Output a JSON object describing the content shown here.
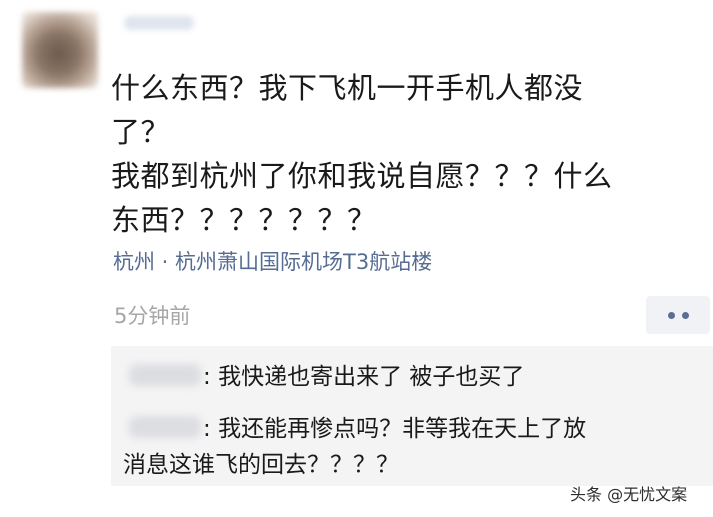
{
  "post": {
    "text_lines": [
      "什么东西？我下飞机一开手机人都没",
      "了？",
      "我都到杭州了你和我说自愿？？？什么",
      "东西？？？？？？？"
    ],
    "location": "杭州 · 杭州萧山国际机场T3航站楼",
    "time": "5分钟前"
  },
  "more_icon": "more-dots-icon",
  "comments": {
    "items": [
      {
        "separator": ":",
        "text": "我快递也寄出来了 被子也买了"
      },
      {
        "separator": ":",
        "text": "我还能再惨点吗？非等我在天上了放",
        "continuation": "消息这谁飞的回去？？？？"
      }
    ]
  },
  "watermark": "头条 @无忧文案",
  "colors": {
    "link": "#566c93",
    "muted": "#a6a6a6",
    "comment_bg": "#f4f4f5",
    "more_dots": "#5b6d92"
  }
}
